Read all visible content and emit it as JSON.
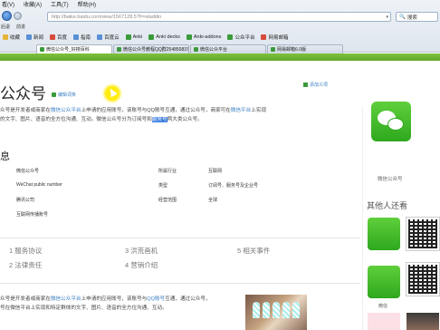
{
  "browser": {
    "menu": [
      "看(V)",
      "收藏(A)",
      "工具(T)",
      "帮助(H)"
    ],
    "back_label": "后退",
    "forward_label": "前进",
    "address": "http://baike.baidu.com/view/1567128.5?fr=aladdin",
    "search_label": "搜索",
    "bookmarks": [
      {
        "label": "收藏",
        "color": "#e6b43b"
      },
      {
        "label": "新闻",
        "color": "#5a8fd6"
      },
      {
        "label": "百度",
        "color": "#d64b3b"
      },
      {
        "label": "指南",
        "color": "#5a8fd6"
      },
      {
        "label": "百度云",
        "color": "#5a8fd6"
      },
      {
        "label": "Anki",
        "color": "#3b9b3b"
      },
      {
        "label": "Anki decks",
        "color": "#3b9b3b"
      },
      {
        "label": "Anki-addons",
        "color": "#3b9b3b"
      },
      {
        "label": "公众平台",
        "color": "#3b9b3b"
      },
      {
        "label": "网易邮箱",
        "color": "#d64b3b"
      }
    ],
    "tabs": [
      {
        "label": "微信公众号_好搜百科",
        "active": true
      },
      {
        "label": "微信公众号教程QQ群254850837 -...",
        "active": false
      },
      {
        "label": "微信公众平台",
        "active": false
      },
      {
        "label": "网易邮箱6.0版",
        "active": false
      }
    ]
  },
  "article": {
    "title": "公众号",
    "edit_label": "编辑词条",
    "add_ref_label": "添加义项",
    "intro": {
      "p1a": "众号是开发者或商家在",
      "p1link": "微信公众平台",
      "p1b": "上申请的应用账号，该账号与QQ账号互通，通过公众号，商家可在",
      "p1link2": "微信平台",
      "p1c": "上实现",
      "p2a": "的文字、图片、语音的全方位沟通、互动。",
      "p2b": "微信公众号分为订阅号和",
      "p2hl": "服务号",
      "p2c": "两大类公众号。"
    },
    "section_title": "息",
    "info": [
      {
        "label": "中文名称",
        "value": "微信公众号"
      },
      {
        "label": "外文名称",
        "value": "WeChat public number"
      },
      {
        "label": "所属",
        "value": "腾讯公司"
      },
      {
        "label": "功能",
        "value": "互联网传播账号"
      },
      {
        "label": "所属行业",
        "value": "互联网"
      },
      {
        "label": "类型",
        "value": "订阅号、服务号及企业号"
      },
      {
        "label": "经营范围",
        "value": "全球"
      }
    ],
    "categories": [
      {
        "num": "1",
        "label": "服务协议"
      },
      {
        "num": "2",
        "label": "法律责任"
      },
      {
        "num": "3",
        "label": "洪荒画机"
      },
      {
        "num": "4",
        "label": "营销介绍"
      },
      {
        "num": "5",
        "label": "相关事件"
      }
    ],
    "body2": {
      "l1a": "众号是开发者或商家在",
      "l1link": "微信公众平台",
      "l1b": "上申请的应用账号，该账号与",
      "l1link2": "QQ账号",
      "l1c": "互通，通过公众号，",
      "l2": "号在微信平台上实现和特定群体的文字、图片、语音的全方位沟通、互动。"
    }
  },
  "sidebar": {
    "caption": "微信公众号",
    "others_title": "其他人还看",
    "thumb_caption": "微信"
  }
}
